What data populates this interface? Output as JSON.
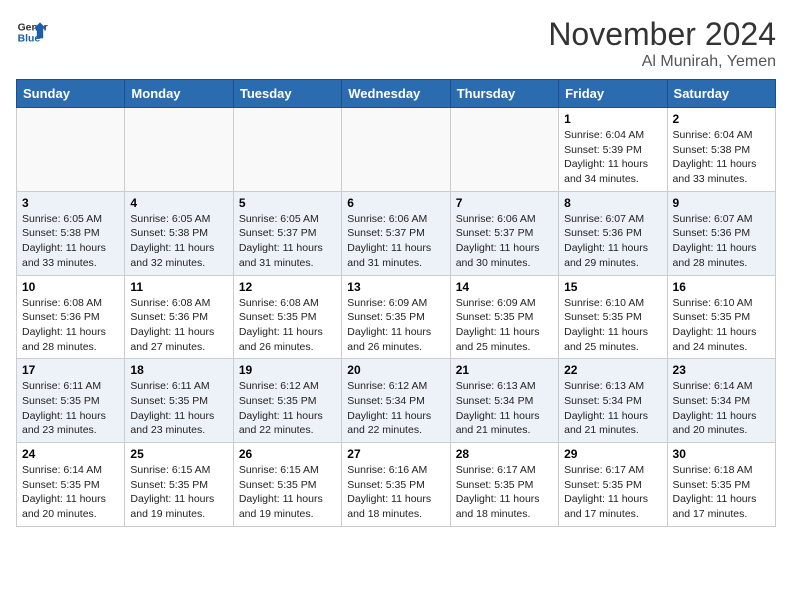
{
  "header": {
    "logo_line1": "General",
    "logo_line2": "Blue",
    "month": "November 2024",
    "location": "Al Munirah, Yemen"
  },
  "days_of_week": [
    "Sunday",
    "Monday",
    "Tuesday",
    "Wednesday",
    "Thursday",
    "Friday",
    "Saturday"
  ],
  "weeks": [
    [
      {
        "day": "",
        "info": ""
      },
      {
        "day": "",
        "info": ""
      },
      {
        "day": "",
        "info": ""
      },
      {
        "day": "",
        "info": ""
      },
      {
        "day": "",
        "info": ""
      },
      {
        "day": "1",
        "info": "Sunrise: 6:04 AM\nSunset: 5:39 PM\nDaylight: 11 hours\nand 34 minutes."
      },
      {
        "day": "2",
        "info": "Sunrise: 6:04 AM\nSunset: 5:38 PM\nDaylight: 11 hours\nand 33 minutes."
      }
    ],
    [
      {
        "day": "3",
        "info": "Sunrise: 6:05 AM\nSunset: 5:38 PM\nDaylight: 11 hours\nand 33 minutes."
      },
      {
        "day": "4",
        "info": "Sunrise: 6:05 AM\nSunset: 5:38 PM\nDaylight: 11 hours\nand 32 minutes."
      },
      {
        "day": "5",
        "info": "Sunrise: 6:05 AM\nSunset: 5:37 PM\nDaylight: 11 hours\nand 31 minutes."
      },
      {
        "day": "6",
        "info": "Sunrise: 6:06 AM\nSunset: 5:37 PM\nDaylight: 11 hours\nand 31 minutes."
      },
      {
        "day": "7",
        "info": "Sunrise: 6:06 AM\nSunset: 5:37 PM\nDaylight: 11 hours\nand 30 minutes."
      },
      {
        "day": "8",
        "info": "Sunrise: 6:07 AM\nSunset: 5:36 PM\nDaylight: 11 hours\nand 29 minutes."
      },
      {
        "day": "9",
        "info": "Sunrise: 6:07 AM\nSunset: 5:36 PM\nDaylight: 11 hours\nand 28 minutes."
      }
    ],
    [
      {
        "day": "10",
        "info": "Sunrise: 6:08 AM\nSunset: 5:36 PM\nDaylight: 11 hours\nand 28 minutes."
      },
      {
        "day": "11",
        "info": "Sunrise: 6:08 AM\nSunset: 5:36 PM\nDaylight: 11 hours\nand 27 minutes."
      },
      {
        "day": "12",
        "info": "Sunrise: 6:08 AM\nSunset: 5:35 PM\nDaylight: 11 hours\nand 26 minutes."
      },
      {
        "day": "13",
        "info": "Sunrise: 6:09 AM\nSunset: 5:35 PM\nDaylight: 11 hours\nand 26 minutes."
      },
      {
        "day": "14",
        "info": "Sunrise: 6:09 AM\nSunset: 5:35 PM\nDaylight: 11 hours\nand 25 minutes."
      },
      {
        "day": "15",
        "info": "Sunrise: 6:10 AM\nSunset: 5:35 PM\nDaylight: 11 hours\nand 25 minutes."
      },
      {
        "day": "16",
        "info": "Sunrise: 6:10 AM\nSunset: 5:35 PM\nDaylight: 11 hours\nand 24 minutes."
      }
    ],
    [
      {
        "day": "17",
        "info": "Sunrise: 6:11 AM\nSunset: 5:35 PM\nDaylight: 11 hours\nand 23 minutes."
      },
      {
        "day": "18",
        "info": "Sunrise: 6:11 AM\nSunset: 5:35 PM\nDaylight: 11 hours\nand 23 minutes."
      },
      {
        "day": "19",
        "info": "Sunrise: 6:12 AM\nSunset: 5:35 PM\nDaylight: 11 hours\nand 22 minutes."
      },
      {
        "day": "20",
        "info": "Sunrise: 6:12 AM\nSunset: 5:34 PM\nDaylight: 11 hours\nand 22 minutes."
      },
      {
        "day": "21",
        "info": "Sunrise: 6:13 AM\nSunset: 5:34 PM\nDaylight: 11 hours\nand 21 minutes."
      },
      {
        "day": "22",
        "info": "Sunrise: 6:13 AM\nSunset: 5:34 PM\nDaylight: 11 hours\nand 21 minutes."
      },
      {
        "day": "23",
        "info": "Sunrise: 6:14 AM\nSunset: 5:34 PM\nDaylight: 11 hours\nand 20 minutes."
      }
    ],
    [
      {
        "day": "24",
        "info": "Sunrise: 6:14 AM\nSunset: 5:35 PM\nDaylight: 11 hours\nand 20 minutes."
      },
      {
        "day": "25",
        "info": "Sunrise: 6:15 AM\nSunset: 5:35 PM\nDaylight: 11 hours\nand 19 minutes."
      },
      {
        "day": "26",
        "info": "Sunrise: 6:15 AM\nSunset: 5:35 PM\nDaylight: 11 hours\nand 19 minutes."
      },
      {
        "day": "27",
        "info": "Sunrise: 6:16 AM\nSunset: 5:35 PM\nDaylight: 11 hours\nand 18 minutes."
      },
      {
        "day": "28",
        "info": "Sunrise: 6:17 AM\nSunset: 5:35 PM\nDaylight: 11 hours\nand 18 minutes."
      },
      {
        "day": "29",
        "info": "Sunrise: 6:17 AM\nSunset: 5:35 PM\nDaylight: 11 hours\nand 17 minutes."
      },
      {
        "day": "30",
        "info": "Sunrise: 6:18 AM\nSunset: 5:35 PM\nDaylight: 11 hours\nand 17 minutes."
      }
    ]
  ]
}
